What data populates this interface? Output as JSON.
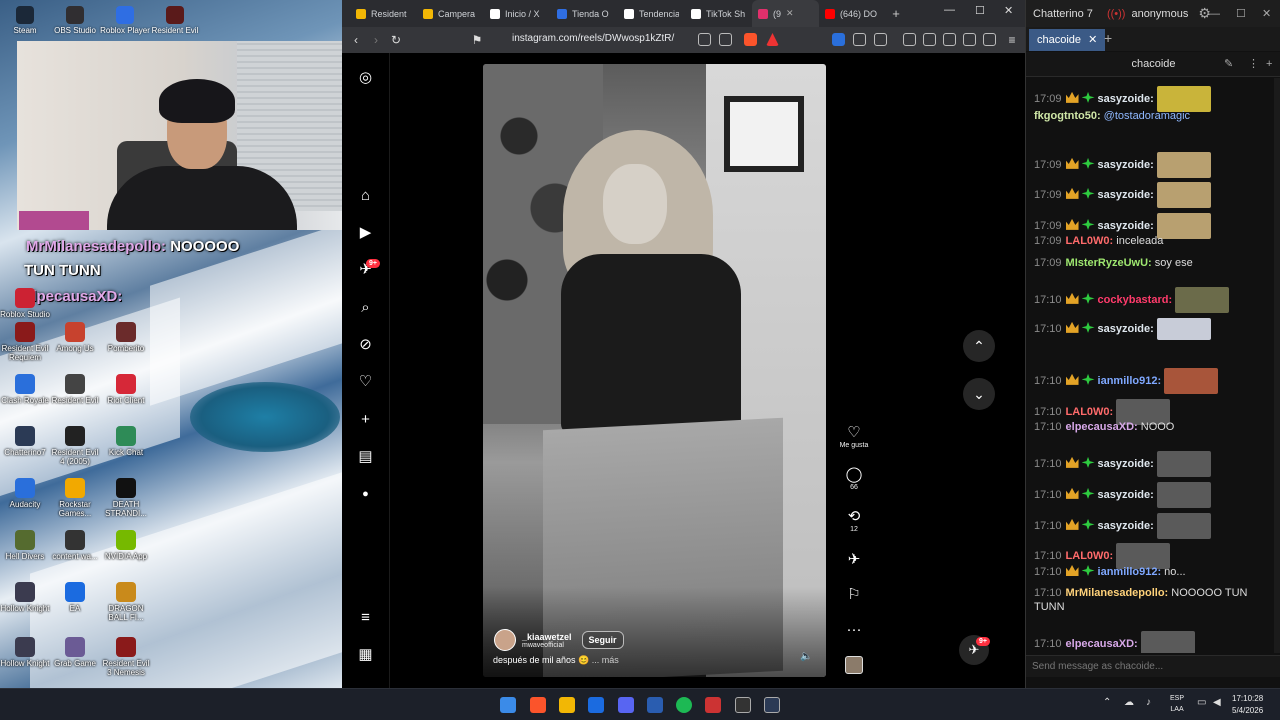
{
  "desktop": {
    "top_icons": [
      "Steam",
      "OBS Studio",
      "Roblox Player",
      "Resident Evil"
    ],
    "overlay": {
      "line1_user": "MrMilanesadepollo:",
      "line1_text": "NOOOOO",
      "line2": "TUN TUNN",
      "line3_user": "elpecausaXD:"
    },
    "icons": [
      {
        "label": "Roblox Studio"
      },
      {
        "label": "Resident Evil Requiem"
      },
      {
        "label": "Among Us"
      },
      {
        "label": "Pomberito"
      },
      {
        "label": "Clash Royale"
      },
      {
        "label": "Resident Evil"
      },
      {
        "label": "Riot Client"
      },
      {
        "label": "Chatterino7"
      },
      {
        "label": "Resident Evil 4 (2005)"
      },
      {
        "label": "Kick Chat"
      },
      {
        "label": "Audacity"
      },
      {
        "label": "Rockstar Games..."
      },
      {
        "label": "DEATH STRANDI..."
      },
      {
        "label": "Hell Divers"
      },
      {
        "label": "content wa..."
      },
      {
        "label": "NVIDIA App"
      },
      {
        "label": "Hollow Knight"
      },
      {
        "label": "EA"
      },
      {
        "label": "DRAGON BALL FI..."
      },
      {
        "label": "Hollow Knight"
      },
      {
        "label": "Grab Game"
      },
      {
        "label": "Resident Evil 3 Nemesis"
      }
    ]
  },
  "browser": {
    "tabs": [
      {
        "title": "Resident",
        "color": "#f2b705"
      },
      {
        "title": "Campera",
        "color": "#f2b705"
      },
      {
        "title": "Inicio / X",
        "color": "#ffffff"
      },
      {
        "title": "Tienda O",
        "color": "#2f6ee3"
      },
      {
        "title": "Tendencia",
        "color": "#ffffff"
      },
      {
        "title": "TikTok Sh",
        "color": "#ffffff"
      },
      {
        "title": "(9",
        "color": "#e1306c",
        "active": true
      },
      {
        "title": "(646) DO",
        "color": "#ff0000"
      }
    ],
    "url": "instagram.com/reels/DWwosp1kZtR/"
  },
  "instagram": {
    "notif_badge": "9+",
    "reel": {
      "username": "_kiaawetzel",
      "audio": "mwaveofficial",
      "follow_label": "Seguir",
      "caption": "después de mil años 😊",
      "more_label": "... más"
    },
    "actions": {
      "like_label": "Me gusta",
      "comments": "66",
      "reposts": "12"
    },
    "share_badge": "9+"
  },
  "chat": {
    "window_title": "Chatterino 7",
    "user": "anonymous",
    "tab": "chacoide",
    "channel": "chacoide",
    "input_placeholder": "Send message as chacoide...",
    "messages": [
      {
        "time": "17:09",
        "user": "sasyzoide:",
        "color": "#dfe7ee",
        "badges": true,
        "text": "",
        "emote": "#c9b43a"
      },
      {
        "time": "",
        "user": "fkgogtnto50:",
        "color": "#cfe7a7",
        "badges": false,
        "text": "@tostadoramagic",
        "text_color": "#8fb8ff"
      },
      {
        "time": "17:09",
        "user": "sasyzoide:",
        "color": "#dfe7ee",
        "badges": true,
        "text": "",
        "emote": "#b8a070"
      },
      {
        "time": "17:09",
        "user": "sasyzoide:",
        "color": "#dfe7ee",
        "badges": true,
        "text": "",
        "emote": "#b8a070"
      },
      {
        "time": "17:09",
        "user": "sasyzoide:",
        "color": "#dfe7ee",
        "badges": true,
        "text": "",
        "emote": "#b8a070"
      },
      {
        "time": "17:09",
        "user": "LAL0W0:",
        "color": "#ff6b6b",
        "badges": false,
        "text": "inceleada"
      },
      {
        "time": "17:09",
        "user": "MIsterRyzeUwU:",
        "color": "#9fe870",
        "badges": false,
        "text": "soy ese"
      },
      {
        "time": "17:10",
        "user": "cockybastard:",
        "color": "#ff3b6b",
        "badges": true,
        "text": "",
        "emote": "#6b6b4a"
      },
      {
        "time": "17:10",
        "user": "sasyzoide:",
        "color": "#dfe7ee",
        "badges": true,
        "text": "",
        "emote": "#c8ccd8"
      },
      {
        "time": "17:10",
        "user": "ianmillo912:",
        "color": "#7fa8ff",
        "badges": true,
        "text": "",
        "emote": "#a8553a"
      },
      {
        "time": "17:10",
        "user": "LAL0W0:",
        "color": "#ff6b6b",
        "badges": false,
        "text": "",
        "emote": "#5a5a5a"
      },
      {
        "time": "17:10",
        "user": "elpecausaXD:",
        "color": "#d7a8e8",
        "badges": false,
        "text": "NOOO"
      },
      {
        "time": "17:10",
        "user": "sasyzoide:",
        "color": "#dfe7ee",
        "badges": true,
        "text": "",
        "emote": "#5a5a5a"
      },
      {
        "time": "17:10",
        "user": "sasyzoide:",
        "color": "#dfe7ee",
        "badges": true,
        "text": "",
        "emote": "#5a5a5a"
      },
      {
        "time": "17:10",
        "user": "sasyzoide:",
        "color": "#dfe7ee",
        "badges": true,
        "text": "",
        "emote": "#5a5a5a"
      },
      {
        "time": "17:10",
        "user": "LAL0W0:",
        "color": "#ff6b6b",
        "badges": false,
        "text": "",
        "emote": "#5a5a5a"
      },
      {
        "time": "17:10",
        "user": "ianmillo912:",
        "color": "#7fa8ff",
        "badges": true,
        "text": "no..."
      },
      {
        "time": "17:10",
        "user": "MrMilanesadepollo:",
        "color": "#ffd27a",
        "badges": false,
        "text": "NOOOOO TUN"
      },
      {
        "time": "",
        "user": "",
        "color": "#ddd",
        "badges": false,
        "text": "TUNN"
      },
      {
        "time": "17:10",
        "user": "elpecausaXD:",
        "color": "#d7a8e8",
        "badges": false,
        "text": "",
        "emote": "#5a5a5a"
      }
    ]
  },
  "taskbar": {
    "lang": "ESP",
    "lang2": "LAA",
    "time": "17:10:28",
    "date": "5/4/2026"
  }
}
